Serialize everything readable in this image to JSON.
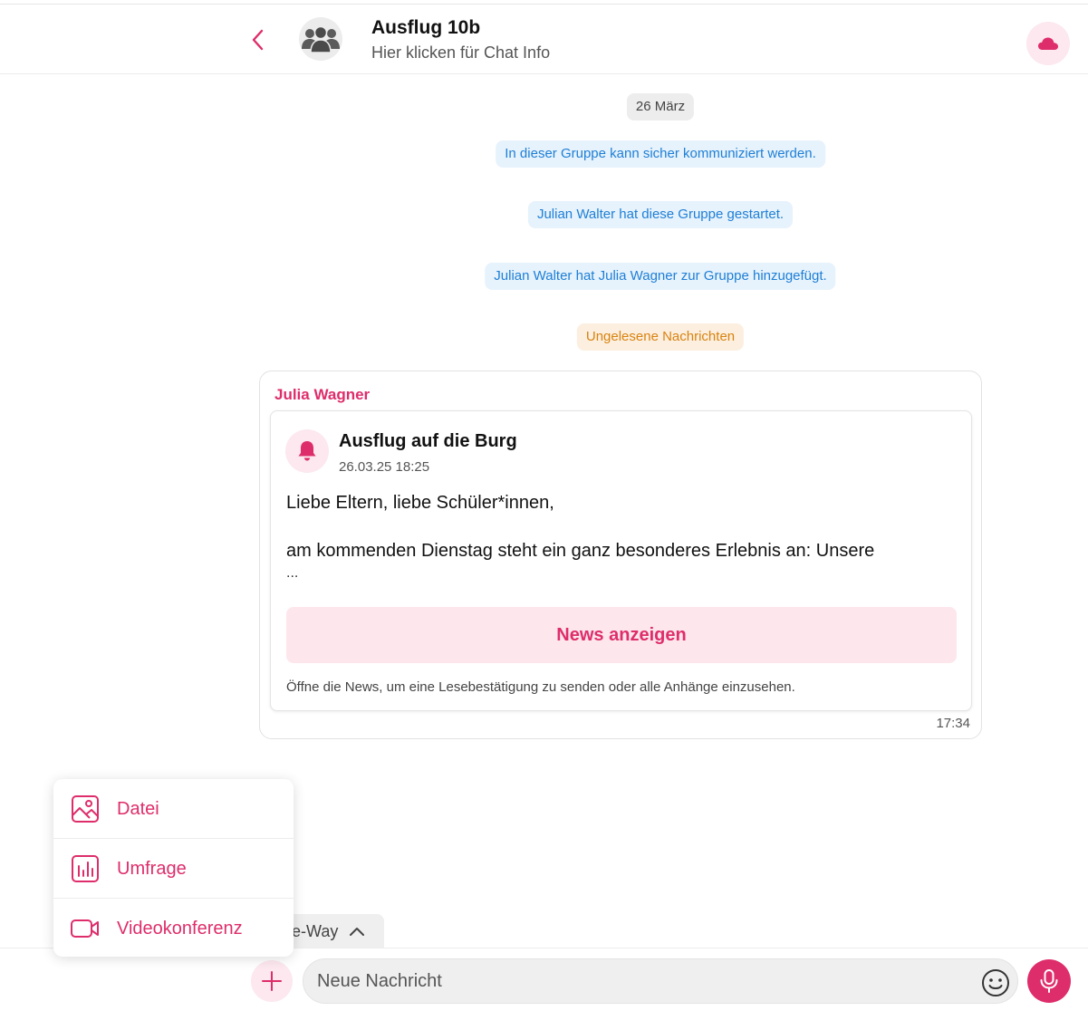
{
  "header": {
    "title": "Ausflug 10b",
    "subtitle": "Hier klicken für Chat Info"
  },
  "chat": {
    "date_label": "26 März",
    "system_messages": [
      "In dieser Gruppe kann sicher kommuniziert werden.",
      "Julian Walter hat diese Gruppe gestartet.",
      "Julian Walter hat Julia Wagner zur Gruppe hinzugefügt."
    ],
    "unread_label": "Ungelesene Nachrichten"
  },
  "message": {
    "sender": "Julia Wagner",
    "time": "17:34",
    "news": {
      "title": "Ausflug auf die Burg",
      "date": "26.03.25 18:25",
      "body_line1": "Liebe Eltern, liebe Schüler*innen,",
      "body_line2": "am kommenden Dienstag steht ein ganz besonderes Erlebnis an: Unsere",
      "ellipsis": "...",
      "button_label": "News anzeigen",
      "hint": "Öffne die News, um eine Lesebestätigung zu senden oder alle Anhänge einzusehen."
    }
  },
  "attach_menu": {
    "items": [
      {
        "label": "Datei",
        "icon": "image-icon"
      },
      {
        "label": "Umfrage",
        "icon": "poll-icon"
      },
      {
        "label": "Videokonferenz",
        "icon": "video-icon"
      }
    ]
  },
  "oneway": {
    "label": "ne-Way"
  },
  "composer": {
    "placeholder": "Neue Nachricht"
  },
  "colors": {
    "accent": "#de2d6b",
    "accent_light": "#fce8ee",
    "info_bg": "#e6f2fc",
    "info_text": "#1e7fd6",
    "unread_bg": "#fcefe0",
    "unread_text": "#d9830f"
  }
}
